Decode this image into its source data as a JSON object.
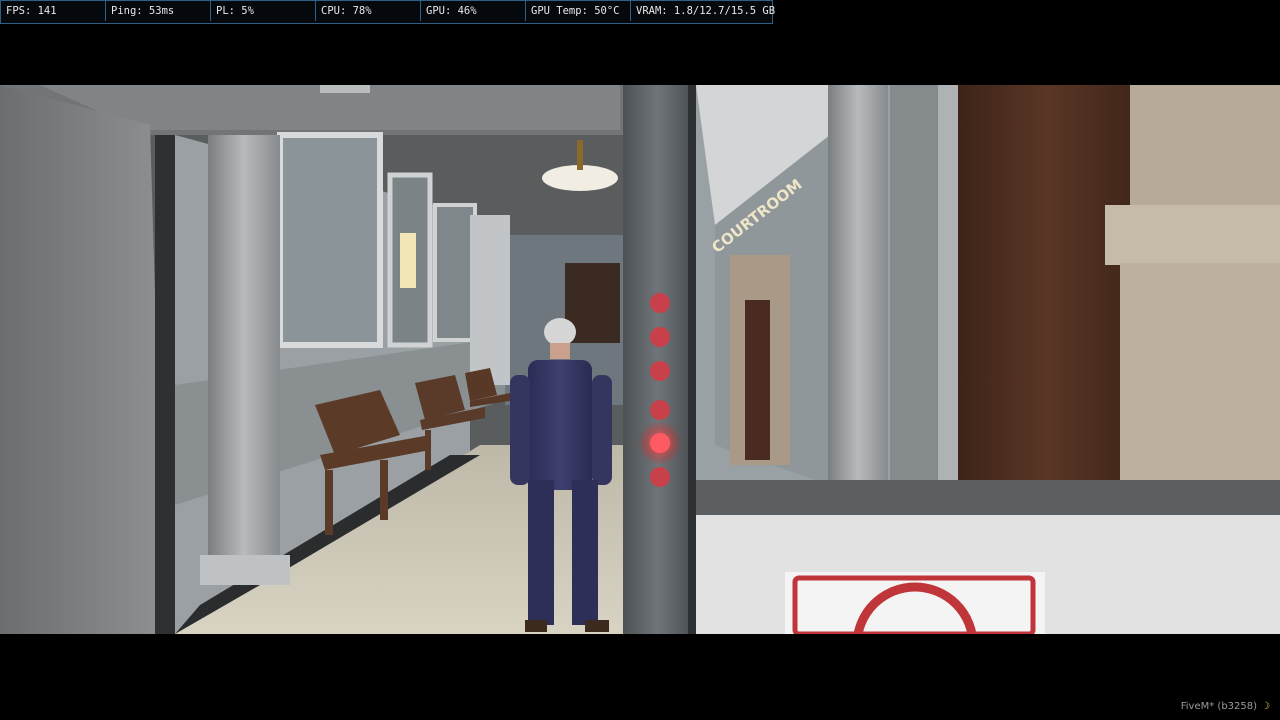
{
  "perf_overlay": {
    "fps": "FPS: 141",
    "ping": "Ping: 53ms",
    "pl": "PL: 5%",
    "cpu": "CPU: 78%",
    "gpu": "GPU: 46%",
    "gpu_temp": "GPU Temp: 50°C",
    "vram": "VRAM: 1.8/12.7/15.5 GB"
  },
  "scene": {
    "sign_text": "COURTROOM",
    "indicator_lights_count": 6
  },
  "watermark": {
    "text": "FiveM* (b3258)",
    "icon": "moon-icon"
  }
}
